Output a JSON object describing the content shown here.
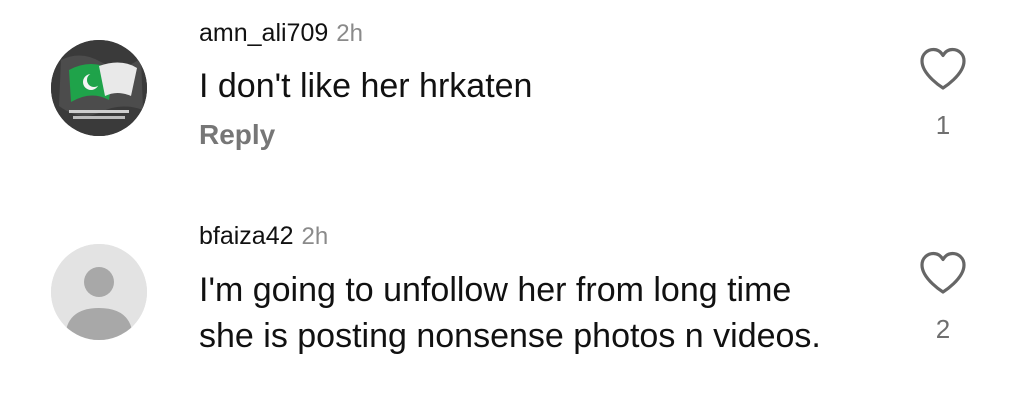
{
  "comments": [
    {
      "username": "amn_ali709",
      "time": "2h",
      "text": "I don't like her hrkaten",
      "reply_label": "Reply",
      "likes": "1",
      "avatar_icon": "flag-avatar-icon"
    },
    {
      "username": "bfaiza42",
      "time": "2h",
      "text": "I'm going to unfollow her from long time she is posting nonsense photos n videos.",
      "likes": "2",
      "avatar_icon": "default-user-avatar-icon"
    }
  ],
  "colors": {
    "text": "#111111",
    "muted": "#8a8a8a",
    "reply": "#767676",
    "default_avatar_bg": "#e3e3e3",
    "default_avatar_fg": "#a8a8a8"
  }
}
